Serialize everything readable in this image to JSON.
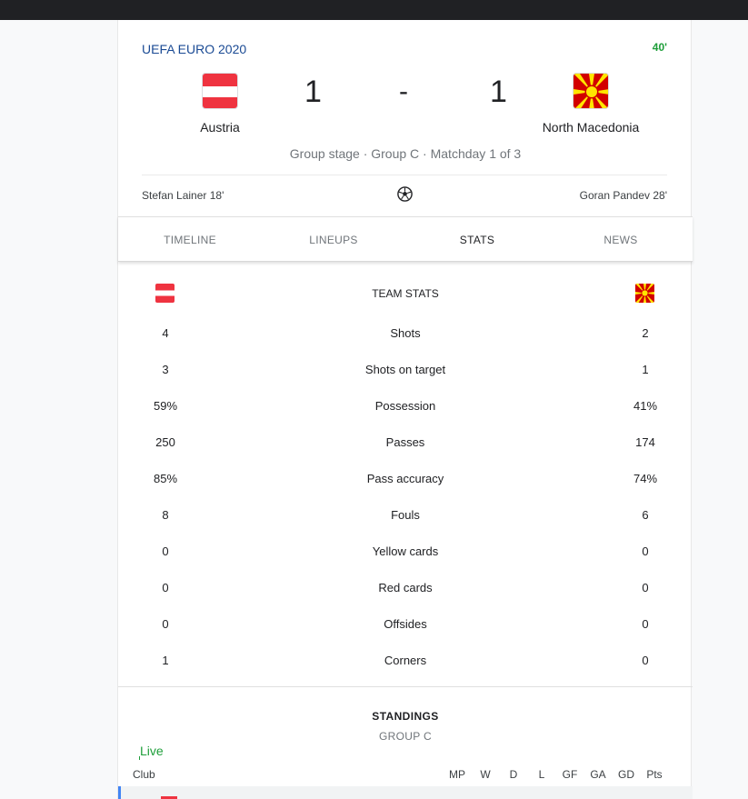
{
  "match": {
    "competition": "UEFA EURO 2020",
    "minute": "40'",
    "home": {
      "name": "Austria",
      "score": "1",
      "scorer": "Stefan Lainer 18'"
    },
    "away": {
      "name": "North Macedonia",
      "score": "1",
      "scorer": "Goran Pandev 28'"
    },
    "separator": "-",
    "stage": "Group stage · Group C · Matchday 1 of 3"
  },
  "tabs": [
    {
      "label": "TIMELINE",
      "active": false
    },
    {
      "label": "LINEUPS",
      "active": false
    },
    {
      "label": "STATS",
      "active": true
    },
    {
      "label": "NEWS",
      "active": false
    }
  ],
  "stats": {
    "title": "TEAM STATS",
    "rows": [
      {
        "label": "Shots",
        "home": "4",
        "away": "2"
      },
      {
        "label": "Shots on target",
        "home": "3",
        "away": "1"
      },
      {
        "label": "Possession",
        "home": "59%",
        "away": "41%"
      },
      {
        "label": "Passes",
        "home": "250",
        "away": "174"
      },
      {
        "label": "Pass accuracy",
        "home": "85%",
        "away": "74%"
      },
      {
        "label": "Fouls",
        "home": "8",
        "away": "6"
      },
      {
        "label": "Yellow cards",
        "home": "0",
        "away": "0"
      },
      {
        "label": "Red cards",
        "home": "0",
        "away": "0"
      },
      {
        "label": "Offsides",
        "home": "0",
        "away": "0"
      },
      {
        "label": "Corners",
        "home": "1",
        "away": "0"
      }
    ]
  },
  "standings": {
    "title": "STANDINGS",
    "group": "GROUP C",
    "live_label": "Live",
    "columns": {
      "club": "Club",
      "mp": "MP",
      "w": "W",
      "d": "D",
      "l": "L",
      "gf": "GF",
      "ga": "GA",
      "gd": "GD",
      "pts": "Pts"
    }
  },
  "colors": {
    "competition_link": "#1a4a94",
    "live_green": "#1e9e3a",
    "austria_red": "#ef3340",
    "macedonia_red": "#d20000",
    "macedonia_yellow": "#ffe600"
  },
  "icons": {
    "ball": "soccer-ball-icon",
    "flag_home": "austria-flag-icon",
    "flag_away": "north-macedonia-flag-icon"
  }
}
